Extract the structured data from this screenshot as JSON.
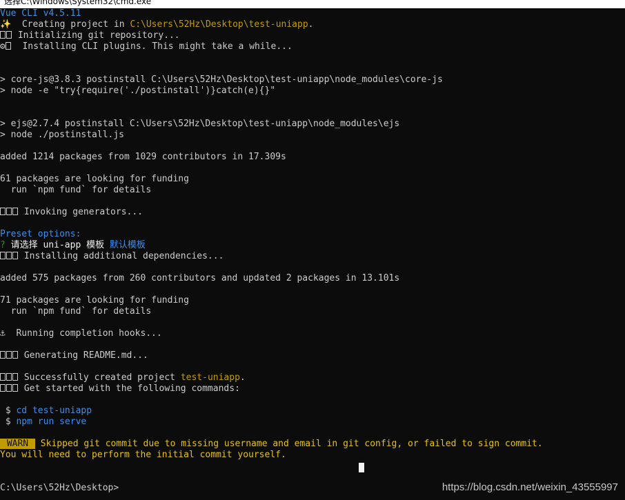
{
  "window": {
    "title": "选择C:\\Windows\\System32\\cmd.exe"
  },
  "terminal": {
    "vue_cli": "Vue CLI v4.5.11",
    "creating_prefix": "✨  Creating project in ",
    "creating_path": "C:\\Users\\52Hz\\Desktop\\test-uniapp",
    "creating_suffix": ".",
    "init_git": " Initializing git repository...",
    "installing_plugins": "  Installing CLI plugins. This might take a while...",
    "corejs_postinstall": "> core-js@3.8.3 postinstall C:\\Users\\52Hz\\Desktop\\test-uniapp\\node_modules\\core-js",
    "corejs_node": "> node -e \"try{require('./postinstall')}catch(e){}\"",
    "ejs_postinstall": "> ejs@2.7.4 postinstall C:\\Users\\52Hz\\Desktop\\test-uniapp\\node_modules\\ejs",
    "ejs_node": "> node ./postinstall.js",
    "added_1": "added 1214 packages from 1029 contributors in 17.309s",
    "funding_1": "61 packages are looking for funding",
    "funding_1_run": "  run `npm fund` for details",
    "invoking": " Invoking generators...",
    "preset_options": "Preset options:",
    "question_mark": "?",
    "question_text": " 请选择 uni-app 模板 ",
    "question_answer": "默认模板",
    "installing_deps": " Installing additional dependencies...",
    "added_2": "added 575 packages from 260 contributors and updated 2 packages in 13.101s",
    "funding_2": "71 packages are looking for funding",
    "funding_2_run": "  run `npm fund` for details",
    "completion_hooks": "⚓  Running completion hooks...",
    "generating_readme": " Generating README.md...",
    "success_prefix": " Successfully created project ",
    "success_project": "test-uniapp",
    "success_suffix": ".",
    "get_started": " Get started with the following commands:",
    "cmd_cd_prompt": " $ ",
    "cmd_cd": "cd test-uniapp",
    "cmd_serve_prompt": " $ ",
    "cmd_serve": "npm run serve",
    "warn_badge": " WARN ",
    "warn_text": " Skipped git commit due to missing username and email in git config, or failed to sign commit.",
    "warn_line2": "You will need to perform the initial commit yourself.",
    "prompt": "C:\\Users\\52Hz\\Desktop>"
  },
  "watermark": "https://blog.csdn.net/weixin_43555997",
  "colors": {
    "background": "#0c0c0c",
    "foreground": "#cccccc",
    "blue": "#3b8eea",
    "yellow": "#c19c00",
    "green": "#13a10e"
  }
}
